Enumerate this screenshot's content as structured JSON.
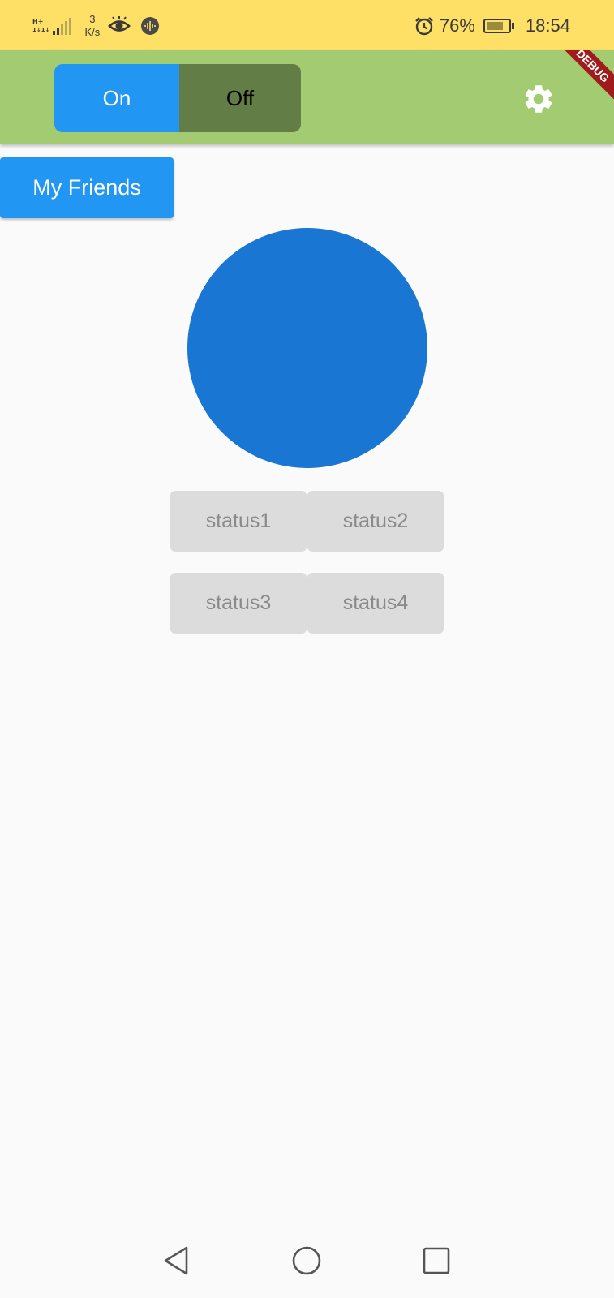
{
  "status_bar": {
    "network_type_top": "H+",
    "network_type_bottom": "1↓1↓",
    "speed_value": "3",
    "speed_unit": "K/s",
    "battery_percent": "76%",
    "battery_level": 0.76,
    "time": "18:54",
    "icons": [
      "signal-icon",
      "eye-icon",
      "audio-wave-icon",
      "alarm-icon",
      "battery-charging-icon"
    ]
  },
  "app_bar": {
    "toggle": {
      "on_label": "On",
      "off_label": "Off",
      "selected": "On"
    },
    "settings_icon": "gear-icon",
    "debug_banner": "DEBUG"
  },
  "main": {
    "friends_button_label": "My Friends",
    "status_buttons": [
      {
        "label": "status1"
      },
      {
        "label": "status2"
      },
      {
        "label": "status3"
      },
      {
        "label": "status4"
      }
    ]
  },
  "nav_bar": {
    "icons": [
      "back-icon",
      "home-icon",
      "recents-icon"
    ]
  },
  "colors": {
    "status_bar_bg": "#FFE066",
    "app_bar_bg": "#A3CB72",
    "toggle_on_bg": "#2196F3",
    "toggle_off_bg": "#637D47",
    "primary_button": "#2196F3",
    "circle": "#1976D2",
    "status_button_bg": "#DCDCDC",
    "status_button_text": "#8A8A8A",
    "debug_banner": "#A01C1C"
  }
}
